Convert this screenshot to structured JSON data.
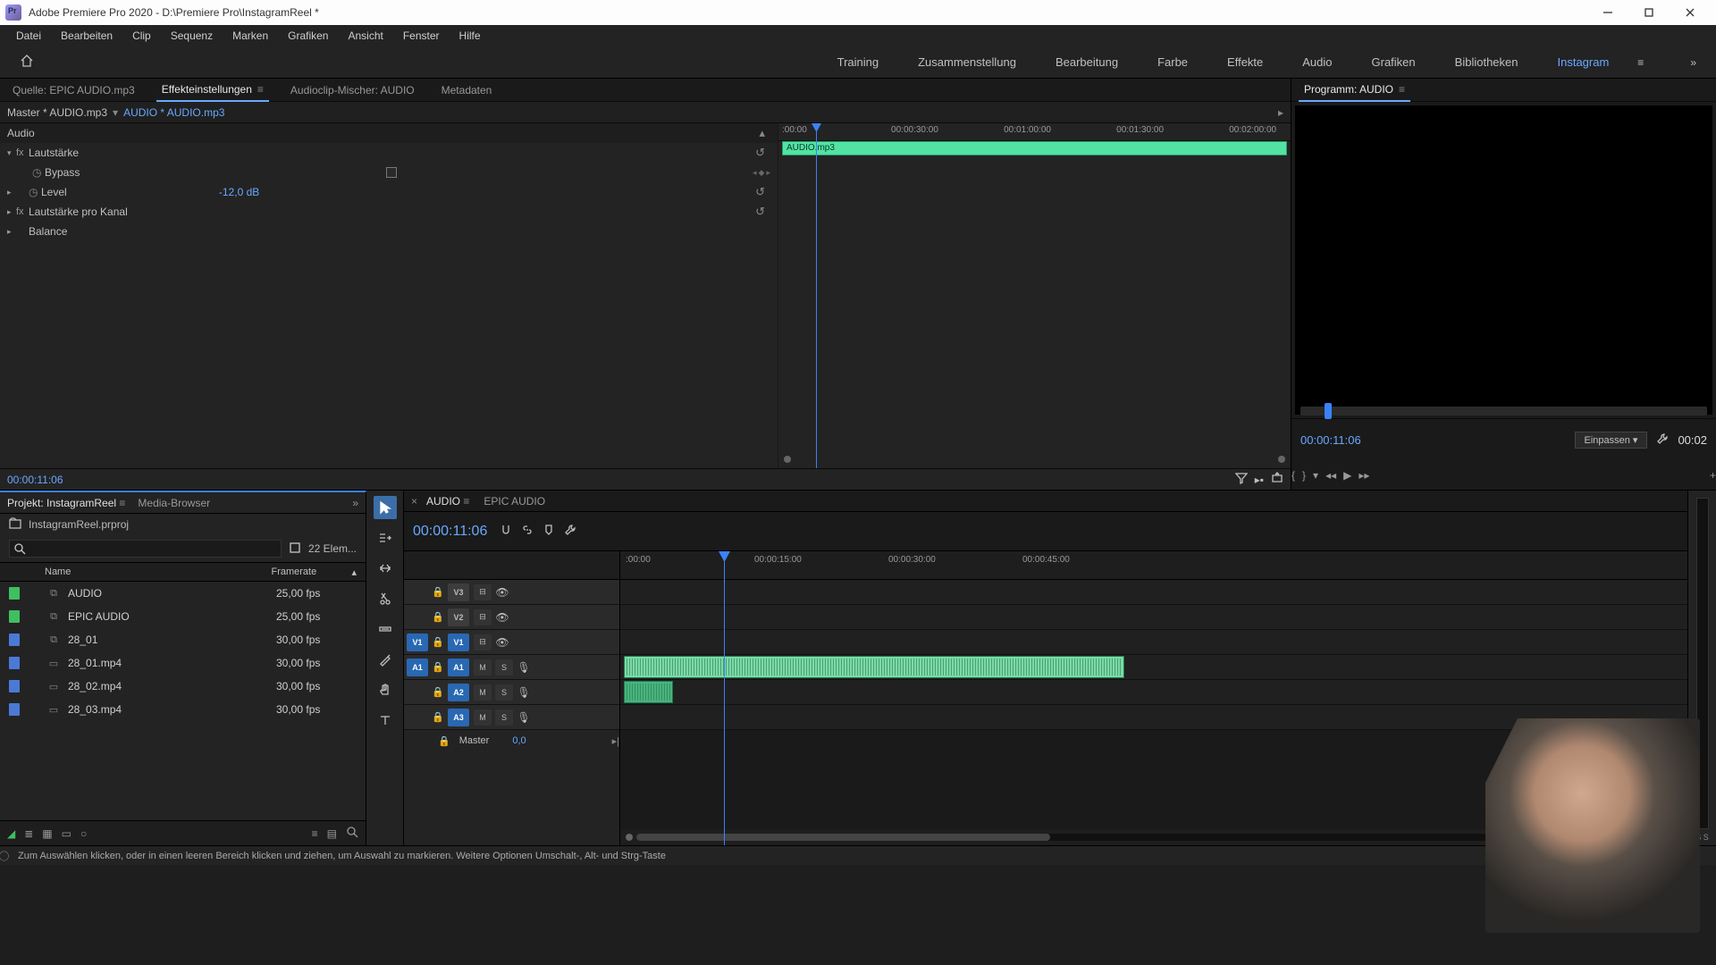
{
  "window": {
    "title": "Adobe Premiere Pro 2020 - D:\\Premiere Pro\\InstagramReel *"
  },
  "menu": [
    "Datei",
    "Bearbeiten",
    "Clip",
    "Sequenz",
    "Marken",
    "Grafiken",
    "Ansicht",
    "Fenster",
    "Hilfe"
  ],
  "workspaces": [
    "Training",
    "Zusammenstellung",
    "Bearbeitung",
    "Farbe",
    "Effekte",
    "Audio",
    "Grafiken",
    "Bibliotheken",
    "Instagram"
  ],
  "workspaces_active": 8,
  "source_tabs": {
    "items": [
      "Quelle: EPIC AUDIO.mp3",
      "Effekteinstellungen",
      "Audioclip-Mischer: AUDIO",
      "Metadaten"
    ],
    "active": 1
  },
  "effect": {
    "master": "Master * AUDIO.mp3",
    "clip": "AUDIO * AUDIO.mp3",
    "category": "Audio",
    "groups": [
      {
        "name": "Lautstärke",
        "rows": [
          {
            "label": "Bypass",
            "type": "check"
          },
          {
            "label": "Level",
            "type": "value",
            "value": "-12,0 dB"
          }
        ]
      },
      {
        "name": "Lautstärke pro Kanal",
        "rows": []
      },
      {
        "name": "Balance",
        "rows": []
      }
    ],
    "mini_ruler": [
      ":00:00",
      "00:00:30:00",
      "00:01:00:00",
      "00:01:30:00",
      "00:02:00:00"
    ],
    "mini_clip": "AUDIO.mp3",
    "timecode": "00:00:11:06"
  },
  "program": {
    "title": "Programm: AUDIO",
    "tc": "00:00:11:06",
    "zoom": "Einpassen",
    "duration": "00:02"
  },
  "project": {
    "tabs": [
      "Projekt: InstagramReel",
      "Media-Browser"
    ],
    "file": "InstagramReel.prproj",
    "count": "22 Elem...",
    "headers": {
      "name": "Name",
      "framerate": "Framerate"
    },
    "items": [
      {
        "color": "#3fbf5f",
        "icon": "seq",
        "name": "AUDIO",
        "framerate": "25,00 fps"
      },
      {
        "color": "#3fbf5f",
        "icon": "seq",
        "name": "EPIC AUDIO",
        "framerate": "25,00 fps"
      },
      {
        "color": "#4a7ad6",
        "icon": "seq",
        "name": "28_01",
        "framerate": "30,00 fps"
      },
      {
        "color": "#4a7ad6",
        "icon": "clip",
        "name": "28_01.mp4",
        "framerate": "30,00 fps"
      },
      {
        "color": "#4a7ad6",
        "icon": "clip",
        "name": "28_02.mp4",
        "framerate": "30,00 fps"
      },
      {
        "color": "#4a7ad6",
        "icon": "clip",
        "name": "28_03.mp4",
        "framerate": "30,00 fps"
      }
    ]
  },
  "timeline": {
    "tabs": [
      "AUDIO",
      "EPIC AUDIO"
    ],
    "tc": "00:00:11:06",
    "ruler": [
      ":00:00",
      "00:00:15:00",
      "00:00:30:00",
      "00:00:45:00"
    ],
    "video_tracks": [
      "V3",
      "V2",
      "V1"
    ],
    "audio_tracks": [
      "A1",
      "A2",
      "A3"
    ],
    "master": {
      "label": "Master",
      "value": "0,0"
    }
  },
  "status": {
    "hint": "Zum Auswählen klicken, oder in einen leeren Bereich klicken und ziehen, um Auswahl zu markieren. Weitere Optionen Umschalt-, Alt- und Strg-Taste"
  },
  "labels": {
    "search_placeholder": ""
  },
  "meter": {
    "label": "S S"
  }
}
